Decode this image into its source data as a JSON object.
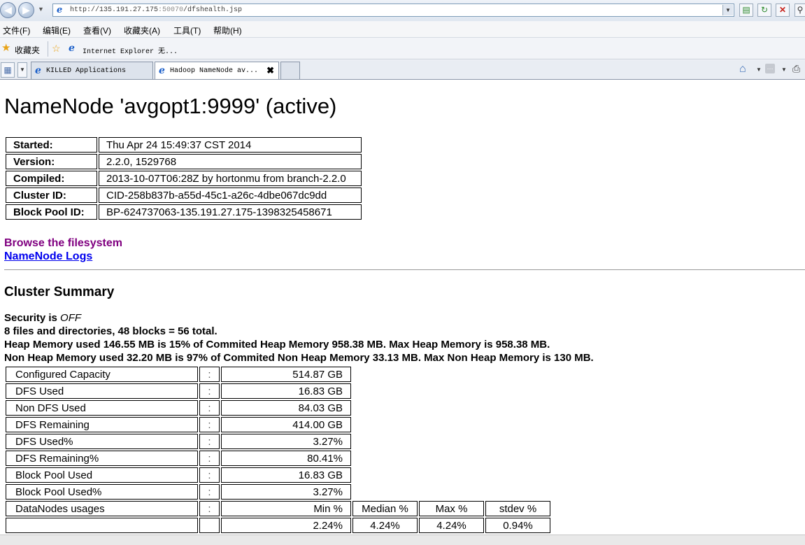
{
  "browser": {
    "url_main": "http://135.191.27.175",
    "url_port": ":50070",
    "url_path": "/dfshealth.jsp",
    "menu": [
      "文件(F)",
      "编辑(E)",
      "查看(V)",
      "收藏夹(A)",
      "工具(T)",
      "帮助(H)"
    ],
    "favorites_label": "收藏夹",
    "favorites_link": "Internet Explorer 无...",
    "tabs": [
      {
        "label": "KILLED Applications",
        "active": false
      },
      {
        "label": "Hadoop NameNode av...",
        "active": true
      }
    ]
  },
  "page": {
    "title": "NameNode 'avgopt1:9999' (active)",
    "info": [
      {
        "key": "Started:",
        "value": "Thu Apr 24 15:49:37 CST 2014"
      },
      {
        "key": "Version:",
        "value": "2.2.0, 1529768"
      },
      {
        "key": "Compiled:",
        "value": "2013-10-07T06:28Z by hortonmu from branch-2.2.0"
      },
      {
        "key": "Cluster ID:",
        "value": "CID-258b837b-a55d-45c1-a26c-4dbe067dc9dd"
      },
      {
        "key": "Block Pool ID:",
        "value": "BP-624737063-135.191.27.175-1398325458671"
      }
    ],
    "links": {
      "browse": "Browse the filesystem",
      "logs": "NameNode Logs"
    },
    "summary_heading": "Cluster Summary",
    "security_prefix": "Security is ",
    "security_state": "OFF",
    "files_line": "8 files and directories, 48 blocks = 56 total.",
    "heap_line": "Heap Memory used 146.55 MB is 15% of Commited Heap Memory 958.38 MB. Max Heap Memory is 958.38 MB.",
    "nonheap_line": "Non Heap Memory used 32.20 MB is 97% of Commited Non Heap Memory 33.13 MB. Max Non Heap Memory is 130 MB.",
    "summary": [
      {
        "name": "Configured Capacity",
        "value": "514.87 GB"
      },
      {
        "name": "DFS Used",
        "value": "16.83 GB"
      },
      {
        "name": "Non DFS Used",
        "value": "84.03 GB"
      },
      {
        "name": "DFS Remaining",
        "value": "414.00 GB"
      },
      {
        "name": "DFS Used%",
        "value": "3.27%"
      },
      {
        "name": "DFS Remaining%",
        "value": "80.41%"
      },
      {
        "name": "Block Pool Used",
        "value": "16.83 GB"
      },
      {
        "name": "Block Pool Used%",
        "value": "3.27%"
      }
    ],
    "colon": ":",
    "datanodes": {
      "label": "DataNodes usages",
      "headers": [
        "Min %",
        "Median %",
        "Max %",
        "stdev %"
      ],
      "values": [
        "2.24%",
        "4.24%",
        "4.24%",
        "0.94%"
      ]
    }
  }
}
